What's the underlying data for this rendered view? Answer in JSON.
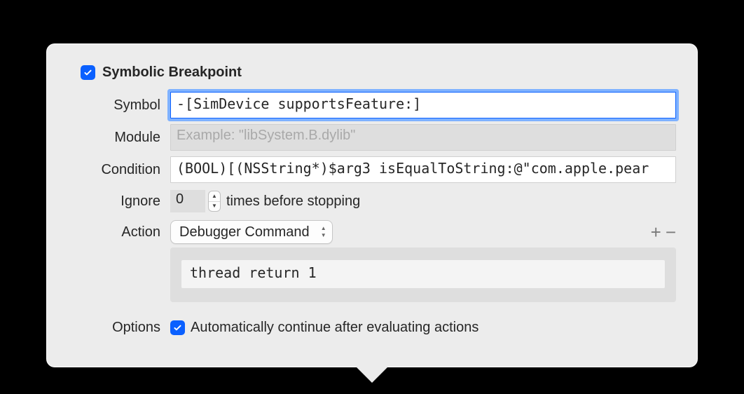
{
  "header": {
    "enabled": true,
    "title": "Symbolic Breakpoint"
  },
  "fields": {
    "symbol": {
      "label": "Symbol",
      "value": "-[SimDevice supportsFeature:]"
    },
    "module": {
      "label": "Module",
      "placeholder": "Example: \"libSystem.B.dylib\"",
      "value": ""
    },
    "condition": {
      "label": "Condition",
      "value": "(BOOL)[(NSString*)$arg3 isEqualToString:@\"com.apple.pear"
    },
    "ignore": {
      "label": "Ignore",
      "value": "0",
      "suffix": "times before stopping"
    },
    "action": {
      "label": "Action",
      "selected": "Debugger Command",
      "command": "thread return 1"
    },
    "options": {
      "label": "Options",
      "checkbox_label": "Automatically continue after evaluating actions",
      "checked": true
    }
  },
  "icons": {
    "plus": "+",
    "minus": "−",
    "caret_up": "˄",
    "caret_down": "˅"
  }
}
